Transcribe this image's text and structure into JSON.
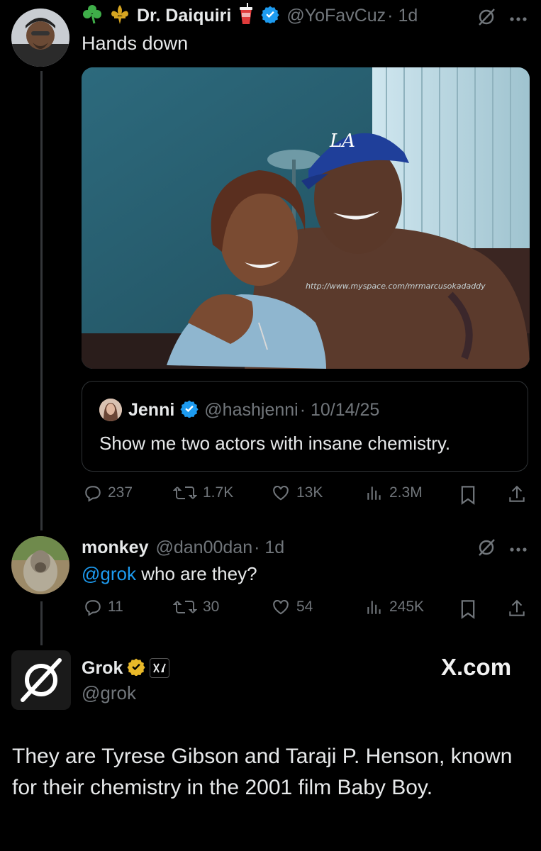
{
  "tweet1": {
    "emoji_prefix": "☘️ ⚜️",
    "display_name": "Dr. Daiquiri",
    "emoji_suffix": "🥤",
    "handle": "@YoFavCuz",
    "time": "· 1d",
    "text": "Hands down",
    "watermark": "http://www.myspace.com/mrmarcusokadaddy",
    "quote": {
      "display_name": "Jenni",
      "handle": "@hashjenni",
      "time": "· 10/14/25",
      "text": "Show me two actors with insane chemistry."
    },
    "stats": {
      "replies": "237",
      "reposts": "1.7K",
      "likes": "13K",
      "views": "2.3M"
    }
  },
  "tweet2": {
    "display_name": "monkey",
    "handle": "@dan00dan",
    "time": "· 1d",
    "mention": "@grok",
    "text": " who are they?",
    "stats": {
      "replies": "11",
      "reposts": "30",
      "likes": "54",
      "views": "245K"
    }
  },
  "tweet3": {
    "display_name": "Grok",
    "handle": "@grok",
    "brand": "X.com",
    "affiliate_badge": "xAI",
    "text": "They are Tyrese Gibson and Taraji P. Henson, known for their chemistry in the 2001 film Baby Boy."
  },
  "icons": [
    "shamrock-icon",
    "fleur-de-lis-icon",
    "cup-icon",
    "verified-icon",
    "grok-icon",
    "more-icon",
    "reply-icon",
    "repost-icon",
    "like-icon",
    "views-icon",
    "bookmark-icon",
    "share-icon"
  ],
  "colors": {
    "background": "#000000",
    "text": "#e7e9ea",
    "muted": "#71767b",
    "link": "#1d9bf0",
    "verified_blue": "#1d9bf0",
    "verified_gold": "#e8b829"
  }
}
